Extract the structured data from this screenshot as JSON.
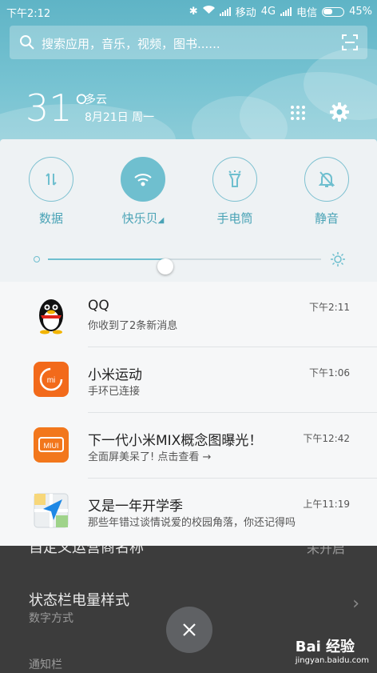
{
  "status_bar": {
    "time": "下午2:12",
    "carrier1": "移动",
    "network": "4G",
    "carrier2": "电信",
    "battery": "45%"
  },
  "search": {
    "placeholder": "搜索应用，音乐，视频，图书......"
  },
  "weather": {
    "temp": "31°",
    "condition": "多云",
    "date": "8月21日 周一"
  },
  "toggles": [
    {
      "label": "数据",
      "icon": "data-arrows-icon",
      "on": false
    },
    {
      "label": "快乐贝",
      "icon": "wifi-icon",
      "on": true
    },
    {
      "label": "手电筒",
      "icon": "flashlight-icon",
      "on": false
    },
    {
      "label": "静音",
      "icon": "bell-muted-icon",
      "on": false
    }
  ],
  "brightness": {
    "level": 0.43
  },
  "notifications": [
    {
      "app": "qq",
      "title": "QQ",
      "body": "你收到了2条新消息",
      "time": "下午2:11"
    },
    {
      "app": "mi-fit",
      "title": "小米运动",
      "body": "手环已连接",
      "time": "下午1:06"
    },
    {
      "app": "miui",
      "title": "下一代小米MIX概念图曝光！",
      "body": "全面屏美呆了! 点击查看 →",
      "time": "下午12:42"
    },
    {
      "app": "maps",
      "title": "又是一年开学季",
      "body": "那些年错过谈情说爱的校园角落，你还记得吗",
      "time": "上午11:19"
    }
  ],
  "background": {
    "row1_title": "自定义运营商名称",
    "row1_value": "未开启",
    "row2_title": "状态栏电量样式",
    "row2_sub": "数字方式",
    "row3_title": "通知栏"
  },
  "watermark": {
    "brand": "Bai 经验",
    "url": "jingyan.baidu.com"
  }
}
